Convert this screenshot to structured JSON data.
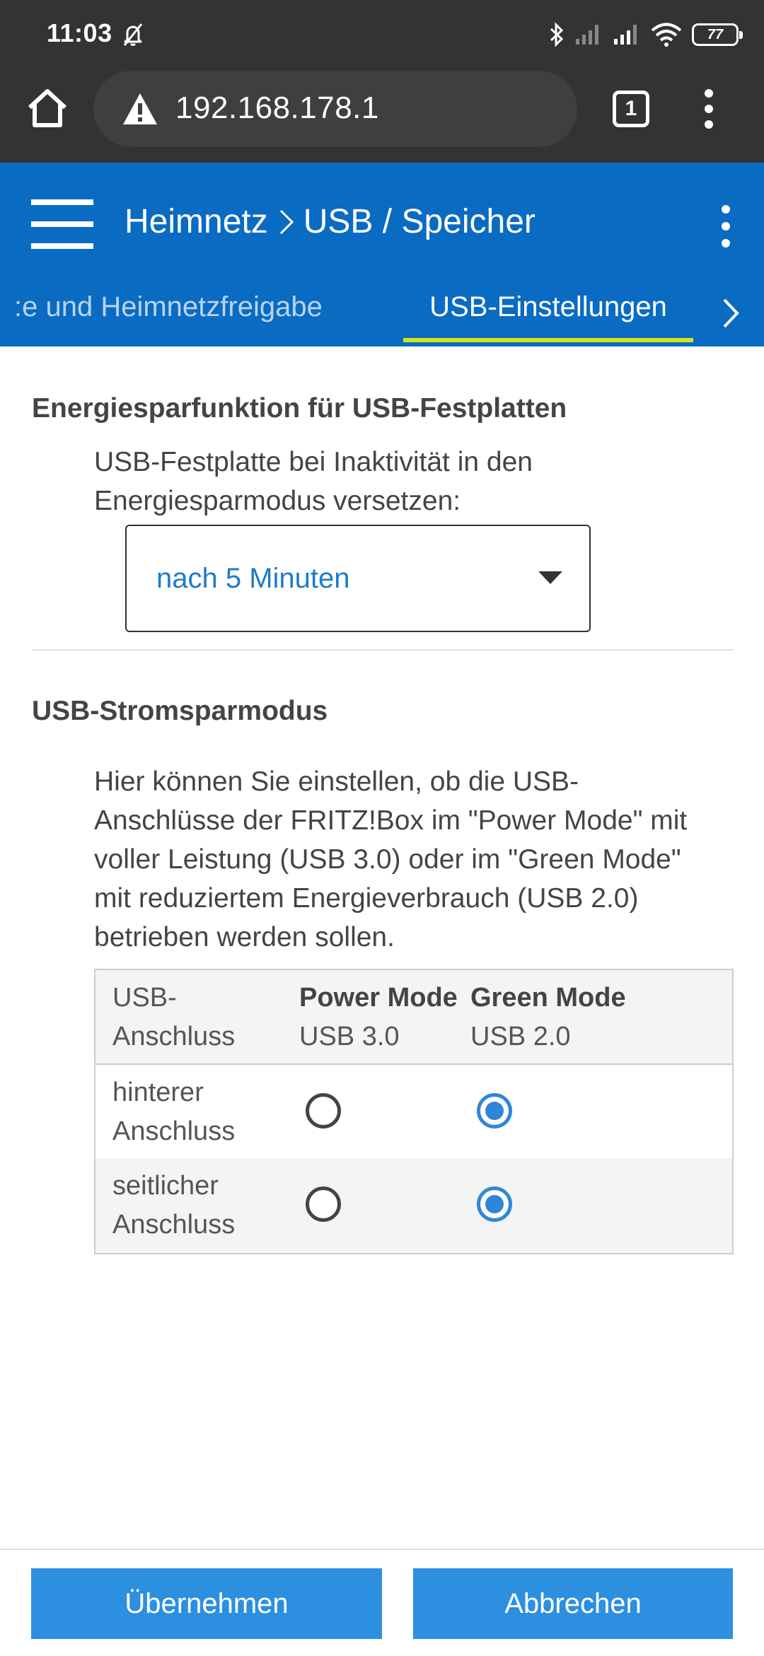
{
  "status_bar": {
    "time": "11:03",
    "battery": "77",
    "icons": [
      "bell-off-icon",
      "bluetooth-icon",
      "signal-icon",
      "signal-icon",
      "wifi-icon",
      "battery-icon"
    ]
  },
  "browser": {
    "url": "192.168.178.1",
    "tab_count": "1",
    "icons": [
      "home-icon",
      "warning-icon",
      "tabs-icon",
      "more-vert-icon"
    ]
  },
  "header": {
    "breadcrumb": [
      "Heimnetz",
      "USB / Speicher"
    ],
    "tabs": [
      {
        "label": ":e und Heimnetzfreigabe",
        "active": false
      },
      {
        "label": "USB-Einstellungen",
        "active": true
      }
    ],
    "accent_color": "#0a6bc2",
    "indicator_color": "#d7e31a"
  },
  "energy_section": {
    "title": "Energiesparfunktion für USB-Festplatten",
    "description_line1": "USB-Festplatte bei Inaktivität in den",
    "description_line2": "Energiesparmodus versetzen:",
    "select_value": "nach 5 Minuten"
  },
  "power_section": {
    "title": "USB-Stromsparmodus",
    "description_lines": [
      "Hier können Sie einstellen, ob die USB-",
      "Anschlüsse der FRITZ!Box im \"Power Mode\" mit",
      "voller Leistung (USB 3.0) oder im \"Green Mode\"",
      "mit reduziertem Energieverbrauch (USB 2.0)",
      "betrieben werden sollen."
    ],
    "table": {
      "headers": {
        "port_line1": "USB-",
        "port_line2": "Anschluss",
        "power_title": "Power Mode",
        "power_sub": "USB 3.0",
        "green_title": "Green Mode",
        "green_sub": "USB 2.0"
      },
      "rows": [
        {
          "line1": "hinterer",
          "line2": "Anschluss",
          "selected": "green"
        },
        {
          "line1": "seitlicher",
          "line2": "Anschluss",
          "selected": "green"
        }
      ]
    }
  },
  "footer": {
    "apply_label": "Übernehmen",
    "cancel_label": "Abbrechen",
    "button_color": "#2d8fe0"
  }
}
